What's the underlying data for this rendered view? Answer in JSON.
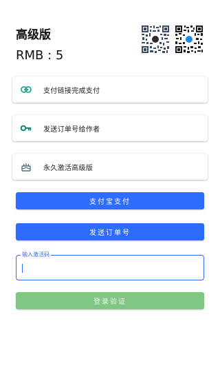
{
  "header": {
    "title": "高级版",
    "price": "RMB : 5"
  },
  "qr_codes": [
    {
      "name": "qr-code-left",
      "badge_color": "#2b2b2b"
    },
    {
      "name": "qr-code-right",
      "badge_color": "#1e88e5"
    }
  ],
  "cards": [
    {
      "label": "支付链接完成支付",
      "icon": "link-icon",
      "icon_color": "#26a69a"
    },
    {
      "label": "发送订单号给作者",
      "icon": "key-icon",
      "icon_color": "#00897b"
    },
    {
      "label": "永久激活高级版",
      "icon": "cake-icon",
      "icon_color": "#546e7a"
    }
  ],
  "buttons": {
    "alipay": "支付宝支付",
    "send_order": "发送订单号",
    "login_verify": "登录验证"
  },
  "activation": {
    "label": "输入激活码",
    "value": ""
  },
  "colors": {
    "primary": "#2e6bff",
    "login_button": "#81c784"
  }
}
